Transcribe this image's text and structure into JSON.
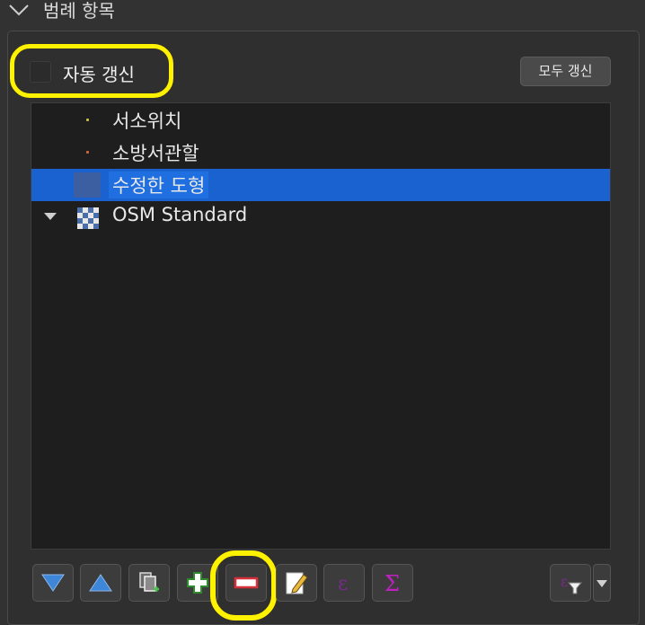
{
  "panel": {
    "title": "범례 항목"
  },
  "auto_update": {
    "label": "자동 갱신",
    "checked": false
  },
  "refresh_all_label": "모두 갱신",
  "legend_items": [
    {
      "label": "서소위치",
      "symbol": "point",
      "color": "#c8c040"
    },
    {
      "label": "소방서관할",
      "symbol": "point",
      "color": "#d0683a"
    },
    {
      "label": "수정한 도형",
      "symbol": "fill",
      "color": "#3b5fa0",
      "selected": true
    },
    {
      "label": "OSM Standard",
      "symbol": "raster",
      "expanded": true
    }
  ],
  "toolbar_icons": [
    "move-down-icon",
    "move-up-icon",
    "add-group-icon",
    "add-item-icon",
    "remove-item-icon",
    "edit-item-icon",
    "expression-icon",
    "sum-icon",
    "filter-icon"
  ],
  "colors": {
    "accent": "#1f6fe0",
    "highlight": "#fff200"
  }
}
